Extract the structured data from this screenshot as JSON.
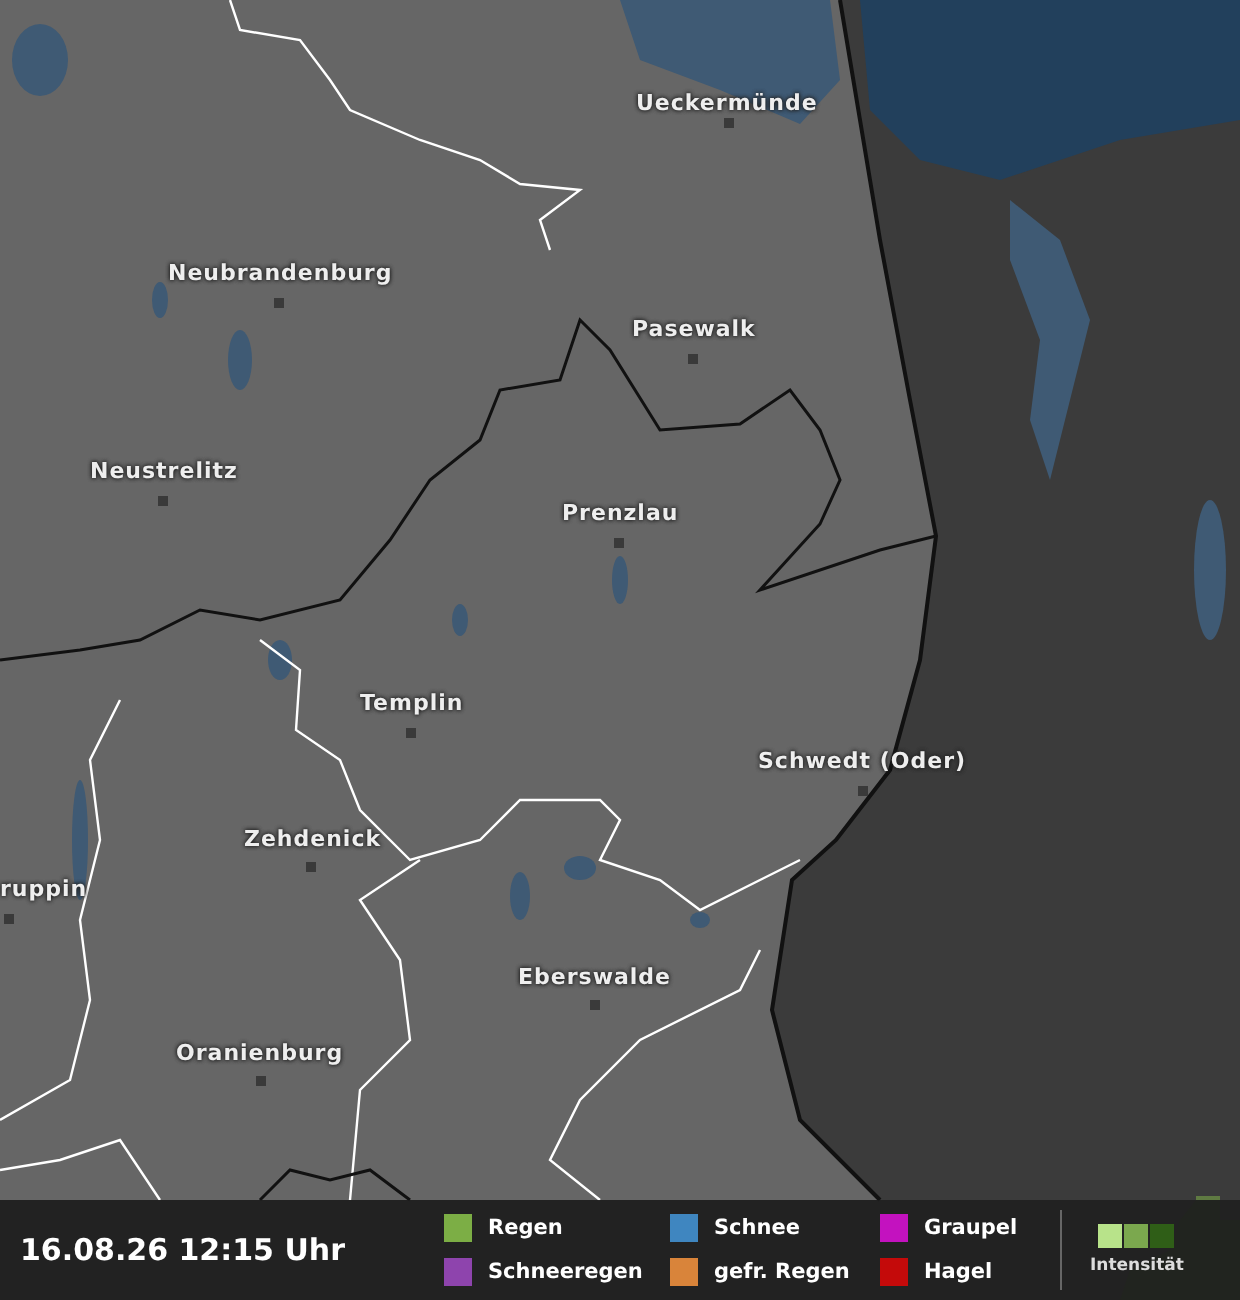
{
  "map": {
    "cities": [
      {
        "name": "Ueckermünde"
      },
      {
        "name": "Neubrandenburg"
      },
      {
        "name": "Pasewalk"
      },
      {
        "name": "Neustrelitz"
      },
      {
        "name": "Prenzlau"
      },
      {
        "name": "Templin"
      },
      {
        "name": "Schwedt (Oder)"
      },
      {
        "name": "Zehdenick"
      },
      {
        "name": "ruppin"
      },
      {
        "name": "Eberswalde"
      },
      {
        "name": "Oranienburg"
      }
    ]
  },
  "status_bar": {
    "timestamp": "16.08.26 12:15 Uhr",
    "legend": [
      {
        "label": "Regen",
        "color": "#7cae45"
      },
      {
        "label": "Schneeregen",
        "color": "#8e44ad"
      },
      {
        "label": "Schnee",
        "color": "#3f86c0"
      },
      {
        "label": "gefr. Regen",
        "color": "#d9843a"
      },
      {
        "label": "Graupel",
        "color": "#c312bf"
      },
      {
        "label": "Hagel",
        "color": "#c40a0a"
      }
    ],
    "intensity": {
      "label": "Intensität",
      "levels": [
        {
          "color": "#b8e38a"
        },
        {
          "color": "#7ba84e"
        },
        {
          "color": "#2f5e17"
        }
      ]
    }
  }
}
